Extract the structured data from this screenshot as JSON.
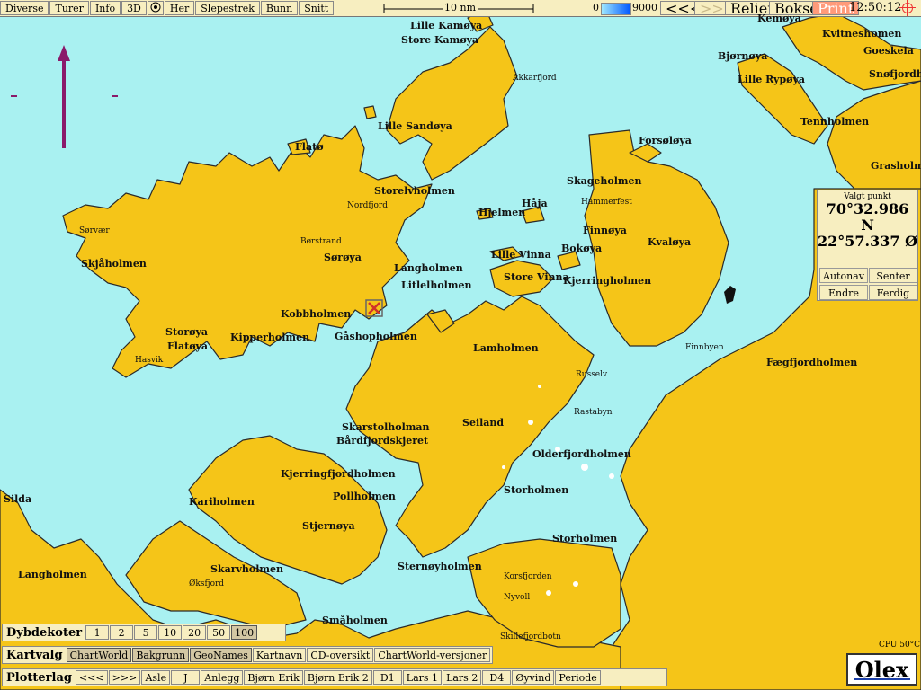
{
  "toolbar": {
    "diverse": "Diverse",
    "turer": "Turer",
    "info": "Info",
    "view3d": "3D",
    "her": "Her",
    "slepestrek": "Slepestrek",
    "bunn": "Bunn",
    "snitt": "Snitt",
    "scale": "10 nm",
    "depth_min": "0",
    "depth_max": "9000",
    "back": "<<<",
    "forward": ">>>",
    "relieff": "Relieff",
    "bokser": "Bokser",
    "print": "Print",
    "clock": "12:50:12"
  },
  "position_panel": {
    "title": "Valgt punkt",
    "lat": "70°32.986 N",
    "lon": "22°57.337 Ø",
    "autonav": "Autonav",
    "senter": "Senter",
    "endre": "Endre",
    "ferdig": "Ferdig"
  },
  "place_labels": [
    "Lille Kamøya",
    "Store Kamøya",
    "Akkarfjord",
    "Lille Sandøya",
    "Flatø",
    "Storelvholmen",
    "Nordfjord",
    "Børstrand",
    "Sørøya",
    "Sørvær",
    "Skjåholmen",
    "Hjelmen",
    "Håja",
    "Langholmen",
    "Litlelholmen",
    "Lille Vinna",
    "Store Vinna",
    "Kjerringholmen",
    "Bokøya",
    "Finnøya",
    "Kvaløya",
    "Hammerfest",
    "Skageholmen",
    "Forsøløya",
    "Kobbholmen",
    "Gåshopholmen",
    "Kipperholmen",
    "Storøya",
    "Flatøya",
    "Hasvik",
    "Lamholmen",
    "Russelv",
    "Rastabyn",
    "Seiland",
    "Skarstolholman",
    "Bårdfjordskjeret",
    "Olderfjordholmen",
    "Kjerringfjordholmen",
    "Pollholmen",
    "Storholmen",
    "Kariholmen",
    "Stjernøya",
    "Silda",
    "Langholmen",
    "Skarvholmen",
    "Øksfjord",
    "Storholmen",
    "Sternøyholmen",
    "Korsfjorden",
    "Nyvoll",
    "Småholmen",
    "Skillefjordbotn",
    "Finnbyen",
    "Fægfjordholmen",
    "Kvitneshomen",
    "Goeskela",
    "Snøfjordholmen",
    "Bjørnøya",
    "Lille Rypøya",
    "Tennholmen",
    "Grasholmen",
    "Kemøya"
  ],
  "bottom": {
    "dybdekoter_label": "Dybdekoter",
    "dybdekoter": [
      "1",
      "2",
      "5",
      "10",
      "20",
      "50",
      "100"
    ],
    "dybdekoter_active": "100",
    "kartvalg_label": "Kartvalg",
    "kartvalg": [
      "ChartWorld",
      "Bakgrunn",
      "GeoNames",
      "Kartnavn",
      "CD-oversikt",
      "ChartWorld-versjoner"
    ],
    "kartvalg_active": [
      "ChartWorld",
      "Bakgrunn",
      "GeoNames"
    ],
    "plotterlag_label": "Plotterlag",
    "plotterlag": [
      "<<<",
      ">>>",
      "Asle",
      "J",
      "Anlegg",
      "Bjørn Erik",
      "Bjørn Erik 2",
      "D1",
      "Lars 1",
      "Lars 2",
      "D4",
      "Øyvind",
      "Periode"
    ]
  },
  "cpu": "CPU 50°C",
  "brand": "Olex",
  "colors": {
    "sea": "#a9f1f1",
    "land": "#f5c518",
    "coast": "#2a2a2a",
    "panel": "#f7eec0",
    "north_arrow": "#8a1a6a",
    "marker": "#d0322a"
  }
}
